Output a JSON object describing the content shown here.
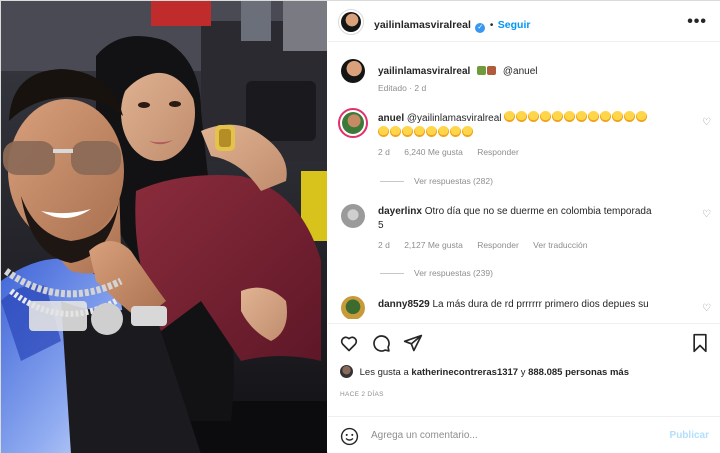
{
  "post": {
    "author": "yailinlamasviralreal",
    "follow_label": "Seguir",
    "separator": "•",
    "more_label": "•••",
    "caption_mention": "@anuel",
    "caption_edited": "Editado · 2 d",
    "likes_prefix": "Les gusta a",
    "likes_user": "katherinecontreras1317",
    "likes_conjunction": "y",
    "likes_rest": "888.085 personas más",
    "time_ago": "HACE 2 DÍAS"
  },
  "comments": [
    {
      "user": "anuel",
      "text": "@yailinlamasviralreal",
      "emoji_line1": 12,
      "emoji_line2": 8,
      "time": "2 d",
      "likes": "6,240 Me gusta",
      "reply": "Responder",
      "replies": "Ver respuestas (282)"
    },
    {
      "user": "dayerlinx",
      "text": "Otro día que no se duerme en colombia temporada",
      "text2": "5",
      "time": "2 d",
      "likes": "2,127 Me gusta",
      "reply": "Responder",
      "translate": "Ver traducción",
      "replies": "Ver respuestas (239)"
    },
    {
      "user": "danny8529",
      "text": "La más dura de rd prrrrrr primero dios depues su"
    }
  ],
  "composer": {
    "placeholder": "Agrega un comentario...",
    "publish_label": "Publicar"
  },
  "icons": {
    "like": "heart-icon",
    "comment": "comment-icon",
    "share": "paper-plane-icon",
    "save": "bookmark-icon",
    "emoji": "smiley-icon"
  },
  "colors": {
    "link": "#0095f6",
    "muted": "#8e8e8e",
    "publish_disabled": "#b2dffc",
    "verified": "#3897f0"
  }
}
